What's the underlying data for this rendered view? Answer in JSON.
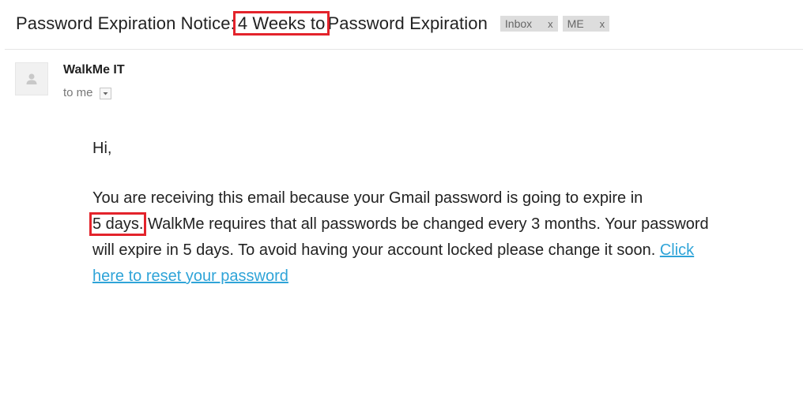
{
  "subject": {
    "prefix": "Password Expiration Notice:",
    "highlight": "4 Weeks to",
    "suffix": "Password Expiration"
  },
  "labels": [
    {
      "name": "Inbox",
      "remove": "x"
    },
    {
      "name": "ME",
      "remove": "x"
    }
  ],
  "sender": {
    "name": "WalkMe IT",
    "recipient": "to me",
    "avatar_icon": "default-person-icon"
  },
  "body": {
    "greeting": "Hi,",
    "line1": "You are receiving this email because your Gmail password is going to expire in",
    "highlight": "5 days.",
    "rest": " WalkMe requires that all passwords be changed every 3 months. Your password will expire in 5 days. To avoid having your account locked please change it soon. ",
    "link_text": "Click here to reset your password"
  },
  "colors": {
    "highlight_border": "#e3232b",
    "link": "#2fa4d8",
    "label_bg": "#dddddd"
  }
}
